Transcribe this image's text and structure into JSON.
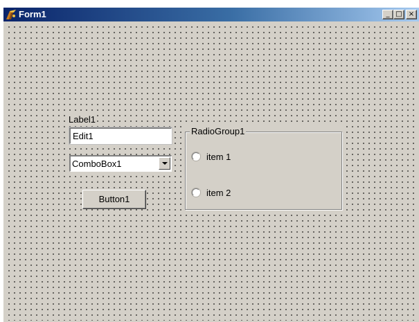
{
  "window": {
    "title": "Form1",
    "icons": {
      "app": "delphi-form-icon",
      "minimize": "minimize-icon",
      "maximize": "maximize-icon",
      "close": "close-icon"
    },
    "caption_glyphs": {
      "minimize": "_",
      "maximize": "□",
      "close": "×"
    }
  },
  "form": {
    "label": "Label1",
    "edit_value": "Edit1",
    "combo_value": "ComboBox1",
    "button_label": "Button1",
    "radio_group": {
      "caption": "RadioGroup1",
      "items": [
        {
          "label": "item 1",
          "checked": false
        },
        {
          "label": "item 2",
          "checked": false
        }
      ]
    }
  },
  "colors": {
    "face": "#d4d0c8",
    "title_gradient_start": "#0a246a",
    "title_gradient_end": "#a6caf0",
    "title_text": "#ffffff"
  }
}
